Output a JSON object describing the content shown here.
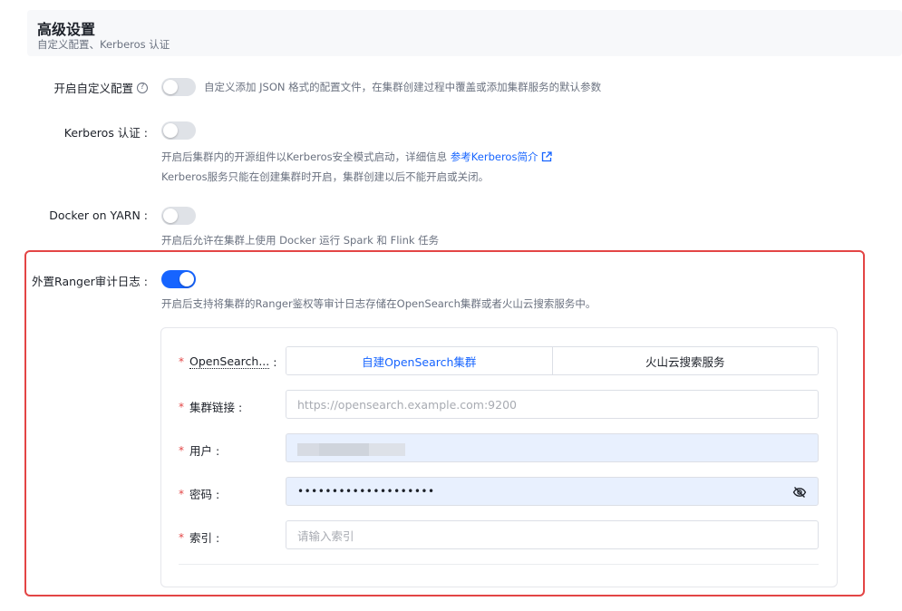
{
  "header": {
    "title": "高级设置",
    "subtitle": "自定义配置、Kerberos 认证"
  },
  "custom_config": {
    "label": "开启自定义配置",
    "help_glyph": "?",
    "enabled": false,
    "description": "自定义添加 JSON 格式的配置文件，在集群创建过程中覆盖或添加集群服务的默认参数"
  },
  "kerberos": {
    "label": "Kerberos 认证 :",
    "enabled": false,
    "description_line1": "开启后集群内的开源组件以Kerberos安全模式启动，详细信息",
    "link_text": "参考Kerberos简介",
    "description_line2": "Kerberos服务只能在创建集群时开启，集群创建以后不能开启或关闭。"
  },
  "docker": {
    "label": "Docker on YARN :",
    "enabled": false,
    "description": "开启后允许在集群上使用 Docker 运行 Spark 和 Flink 任务"
  },
  "ranger": {
    "label": "外置Ranger审计日志 :",
    "enabled": true,
    "description": "开启后支持将集群的Ranger鉴权等审计日志存储在OpenSearch集群或者火山云搜索服务中。"
  },
  "form": {
    "source": {
      "label": "OpenSearch...",
      "colon": ":",
      "options": [
        "自建OpenSearch集群",
        "火山云搜索服务"
      ],
      "selected_index": 0
    },
    "cluster_link": {
      "label": "集群链接 :",
      "placeholder": "https://opensearch.example.com:9200",
      "value": ""
    },
    "user": {
      "label": "用户 :"
    },
    "password": {
      "label": "密码 :",
      "value": "••••••••••••••••••••"
    },
    "index": {
      "label": "索引 :",
      "placeholder": "请输入索引",
      "value": ""
    },
    "required_mark": "*"
  },
  "colors": {
    "accent": "#1664ff",
    "highlight_border": "#e34545",
    "toggle_off": "#dfe2e7",
    "autofill_bg": "#e8f0fe"
  },
  "icons": [
    "help-icon",
    "external-link-icon",
    "eye-off-icon"
  ]
}
